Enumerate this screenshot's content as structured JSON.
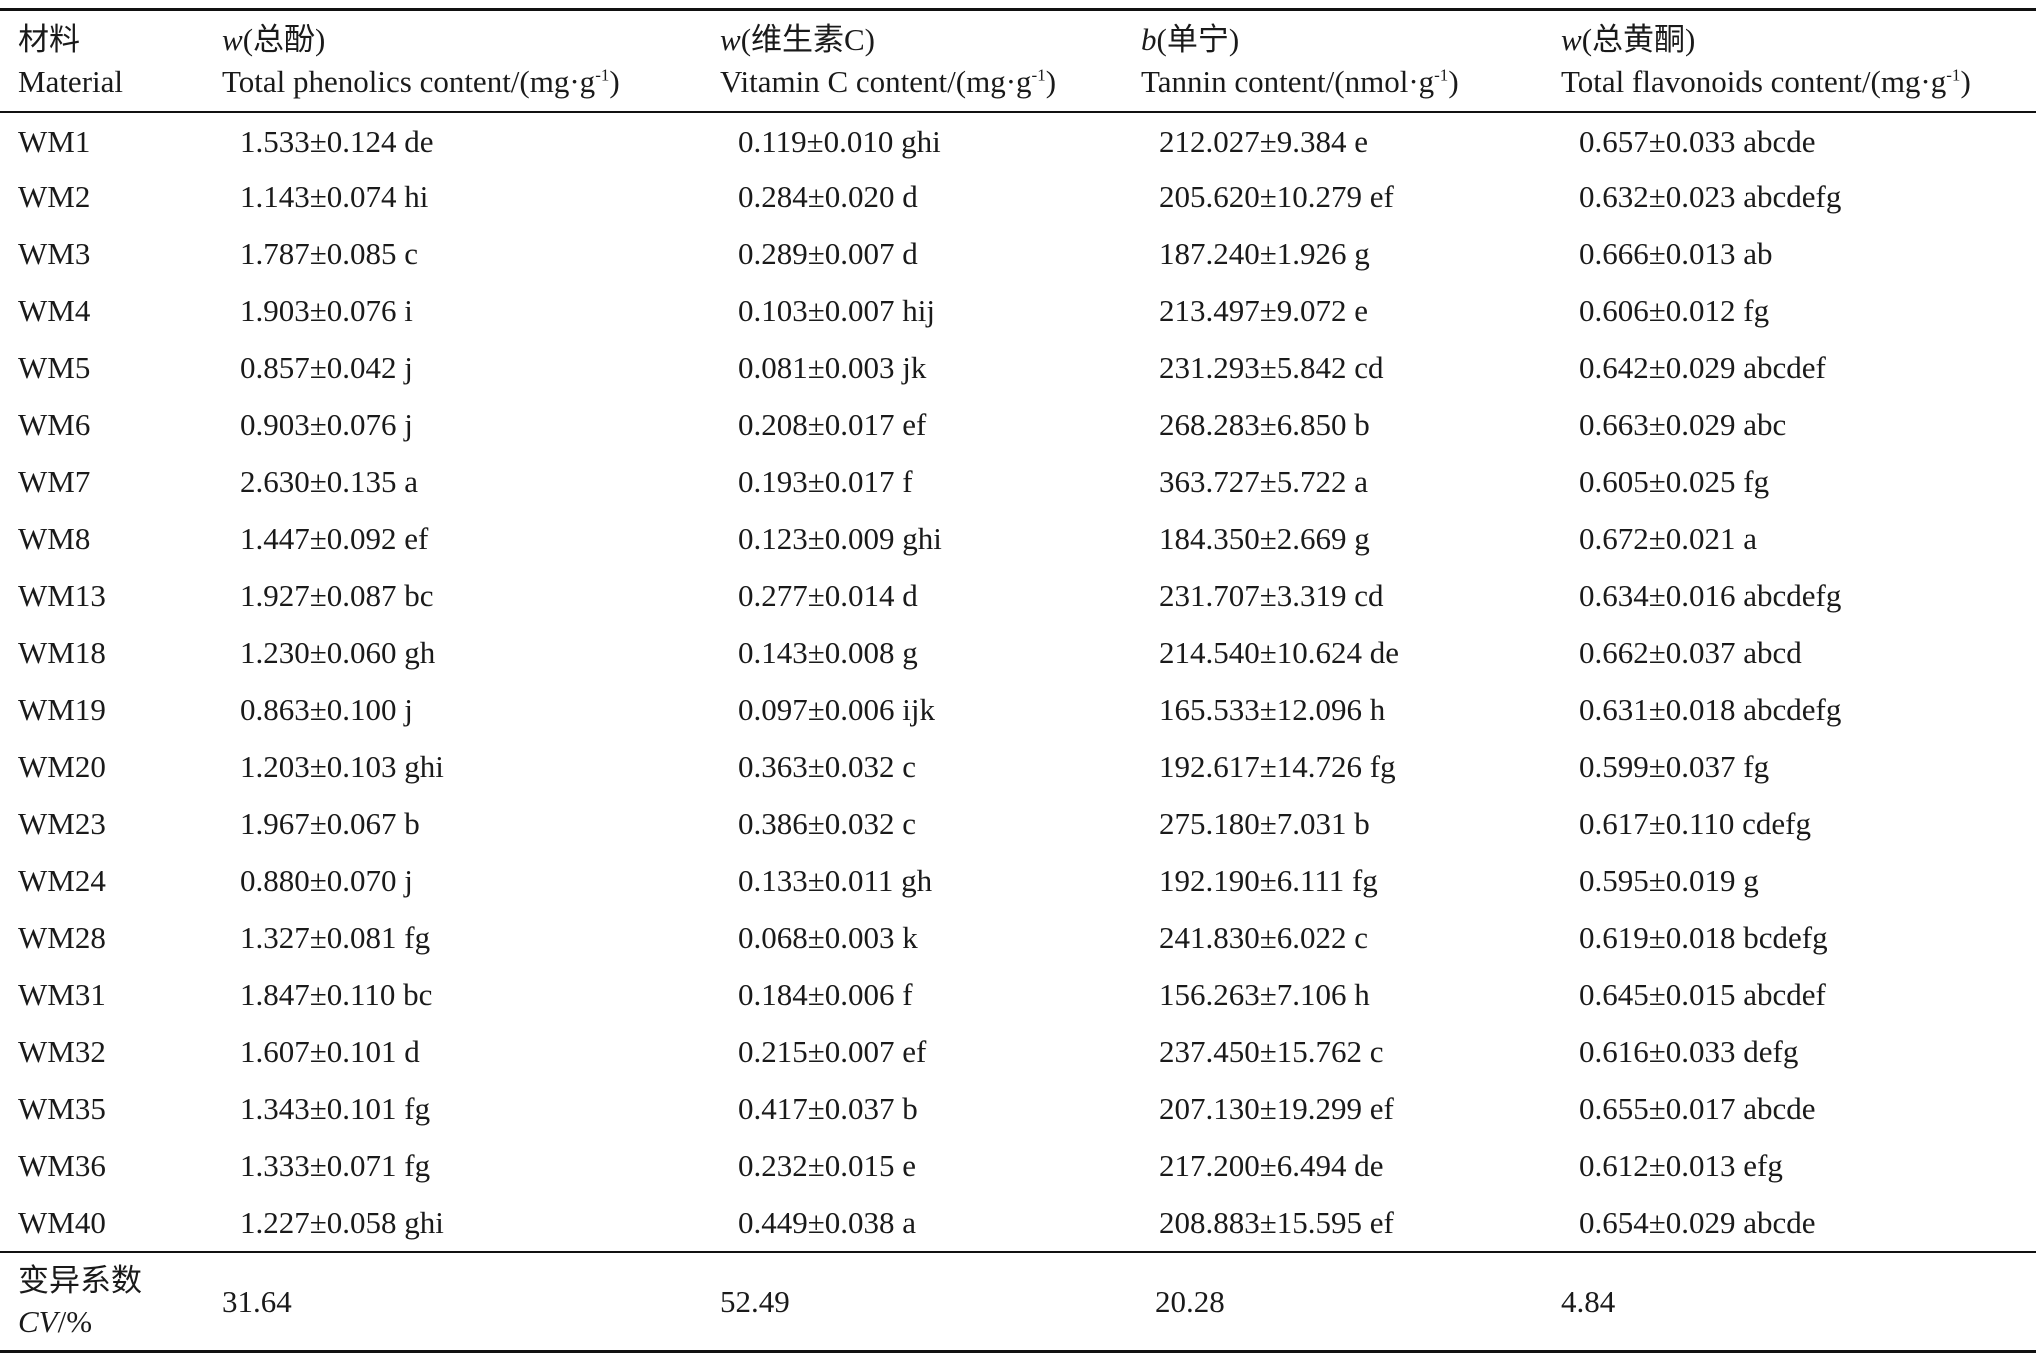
{
  "table": {
    "headers": [
      {
        "cn_prefix": "",
        "cn": "材料",
        "en": "Material",
        "unit": "",
        "unit_tail": ""
      },
      {
        "cn_prefix": "w",
        "cn": "(总酚)",
        "en": "Total phenolics content/",
        "unit": "(mg·g",
        "unit_tail": ")"
      },
      {
        "cn_prefix": "w",
        "cn": "(维生素C)",
        "en": "Vitamin C content/",
        "unit": "(mg·g",
        "unit_tail": ")"
      },
      {
        "cn_prefix": "b",
        "cn": "(单宁)",
        "en": "Tannin content/",
        "unit": "(nmol·g",
        "unit_tail": ")"
      },
      {
        "cn_prefix": "w",
        "cn": "(总黄酮)",
        "en": "Total flavonoids content/",
        "unit": "(mg·g",
        "unit_tail": ")"
      }
    ],
    "superscript": "-1",
    "rows": [
      [
        "WM1",
        "1.533±0.124 de",
        "0.119±0.010 ghi",
        "212.027±9.384 e",
        "0.657±0.033 abcde"
      ],
      [
        "WM2",
        "1.143±0.074 hi",
        "0.284±0.020 d",
        "205.620±10.279 ef",
        "0.632±0.023 abcdefg"
      ],
      [
        "WM3",
        "1.787±0.085 c",
        "0.289±0.007 d",
        "187.240±1.926 g",
        "0.666±0.013 ab"
      ],
      [
        "WM4",
        "1.903±0.076 i",
        "0.103±0.007 hij",
        "213.497±9.072 e",
        "0.606±0.012 fg"
      ],
      [
        "WM5",
        "0.857±0.042 j",
        "0.081±0.003 jk",
        "231.293±5.842 cd",
        "0.642±0.029 abcdef"
      ],
      [
        "WM6",
        "0.903±0.076 j",
        "0.208±0.017 ef",
        "268.283±6.850 b",
        "0.663±0.029 abc"
      ],
      [
        "WM7",
        "2.630±0.135 a",
        "0.193±0.017 f",
        "363.727±5.722 a",
        "0.605±0.025 fg"
      ],
      [
        "WM8",
        "1.447±0.092 ef",
        "0.123±0.009 ghi",
        "184.350±2.669 g",
        "0.672±0.021 a"
      ],
      [
        "WM13",
        "1.927±0.087 bc",
        "0.277±0.014 d",
        "231.707±3.319 cd",
        "0.634±0.016 abcdefg"
      ],
      [
        "WM18",
        "1.230±0.060 gh",
        "0.143±0.008 g",
        "214.540±10.624 de",
        "0.662±0.037 abcd"
      ],
      [
        "WM19",
        "0.863±0.100 j",
        "0.097±0.006 ijk",
        "165.533±12.096 h",
        "0.631±0.018 abcdefg"
      ],
      [
        "WM20",
        "1.203±0.103 ghi",
        "0.363±0.032 c",
        "192.617±14.726 fg",
        "0.599±0.037 fg"
      ],
      [
        "WM23",
        "1.967±0.067 b",
        "0.386±0.032 c",
        "275.180±7.031 b",
        "0.617±0.110 cdefg"
      ],
      [
        "WM24",
        "0.880±0.070 j",
        "0.133±0.011 gh",
        "192.190±6.111 fg",
        "0.595±0.019 g"
      ],
      [
        "WM28",
        "1.327±0.081 fg",
        "0.068±0.003 k",
        "241.830±6.022 c",
        "0.619±0.018 bcdefg"
      ],
      [
        "WM31",
        "1.847±0.110 bc",
        "0.184±0.006 f",
        "156.263±7.106 h",
        "0.645±0.015 abcdef"
      ],
      [
        "WM32",
        "1.607±0.101 d",
        "0.215±0.007 ef",
        "237.450±15.762 c",
        "0.616±0.033 defg"
      ],
      [
        "WM35",
        "1.343±0.101 fg",
        "0.417±0.037 b",
        "207.130±19.299 ef",
        "0.655±0.017 abcde"
      ],
      [
        "WM36",
        "1.333±0.071 fg",
        "0.232±0.015 e",
        "217.200±6.494 de",
        "0.612±0.013 efg"
      ],
      [
        "WM40",
        "1.227±0.058 ghi",
        "0.449±0.038 a",
        "208.883±15.595 ef",
        "0.654±0.029 abcde"
      ]
    ],
    "footer": {
      "label_cn": "变异系数",
      "label_en": "CV",
      "label_unit": "/%",
      "values": [
        "31.64",
        "52.49",
        "20.28",
        "4.84"
      ]
    }
  }
}
